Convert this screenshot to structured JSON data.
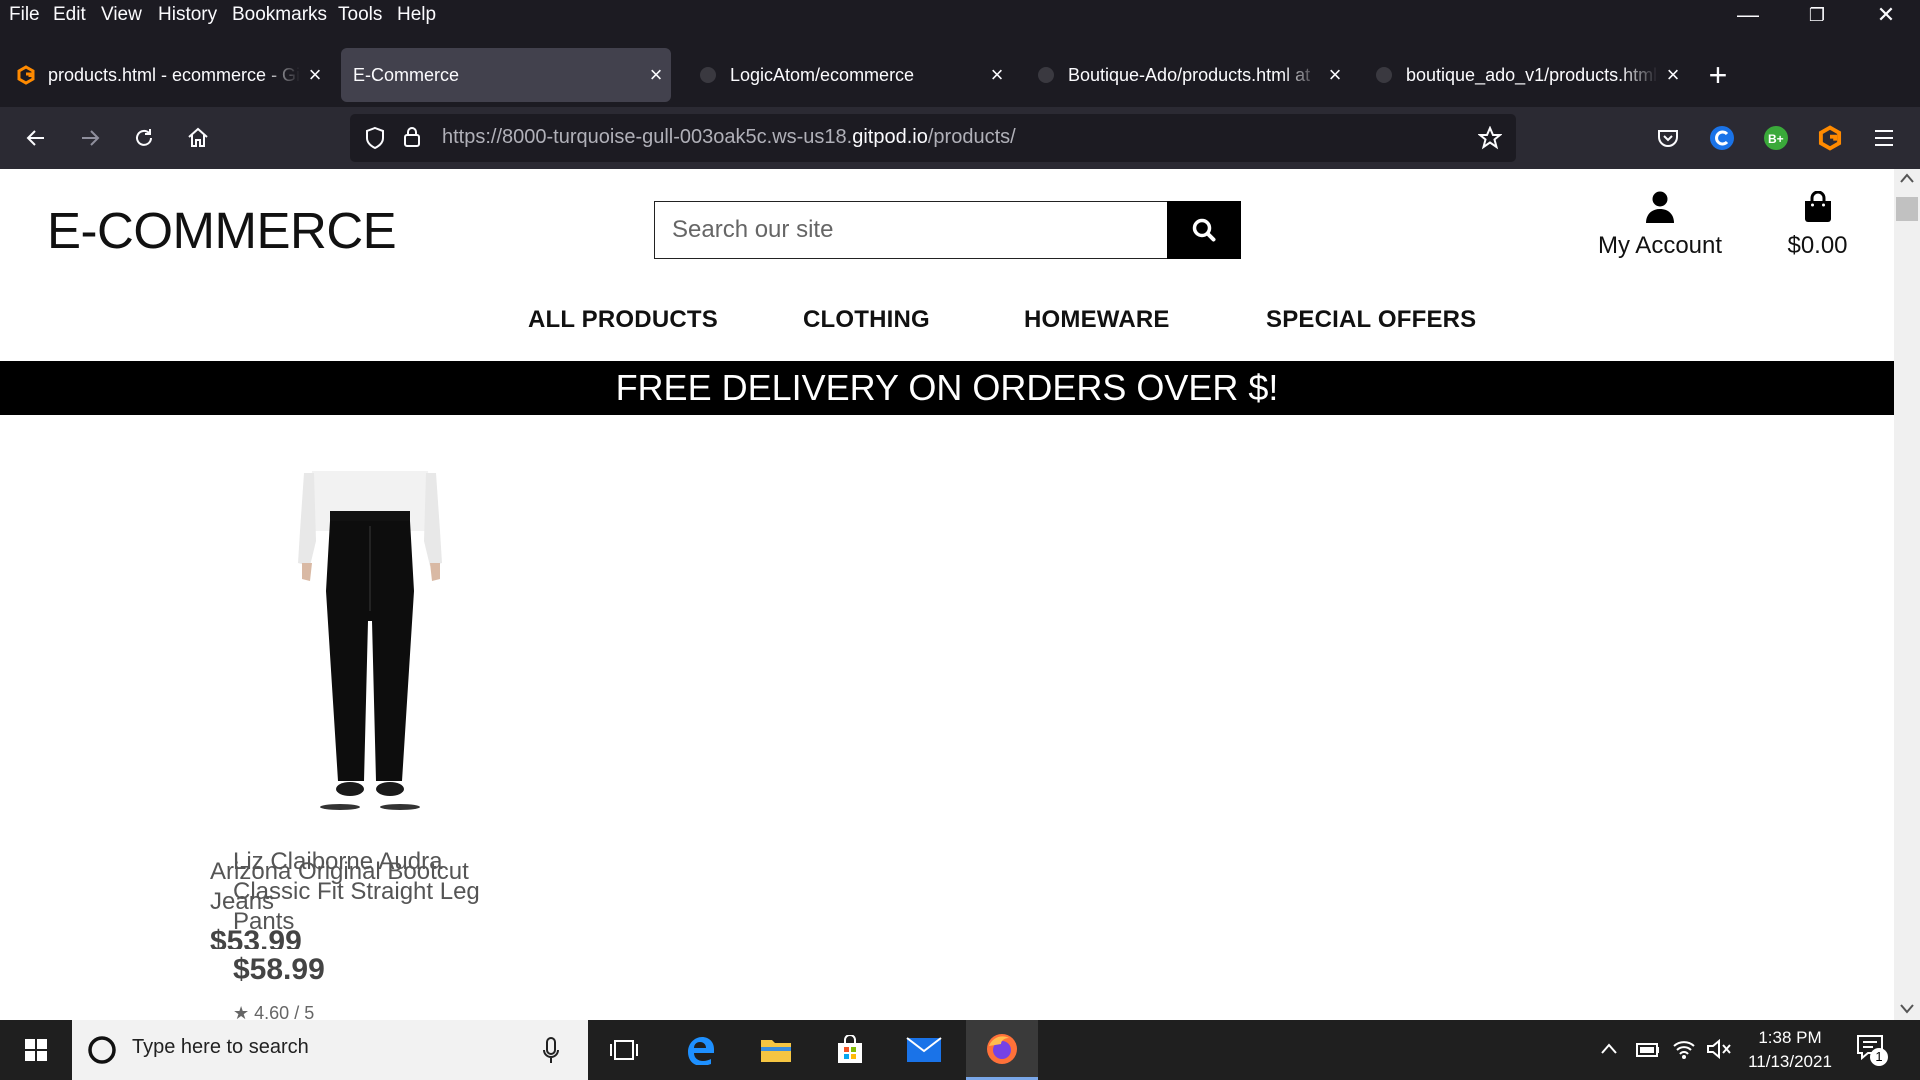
{
  "menubar": {
    "items": [
      "File",
      "Edit",
      "View",
      "History",
      "Bookmarks",
      "Tools",
      "Help"
    ]
  },
  "tabs": [
    {
      "title": "products.html - ecommerce - Gi",
      "favicon": "gitpod-icon",
      "active": false
    },
    {
      "title": "E-Commerce",
      "favicon": "none",
      "active": true
    },
    {
      "title": "LogicAtom/ecommerce",
      "favicon": "github-icon",
      "active": false
    },
    {
      "title": "Boutique-Ado/products.html at",
      "favicon": "github-icon",
      "active": false
    },
    {
      "title": "boutique_ado_v1/products.html",
      "favicon": "github-icon",
      "active": false
    }
  ],
  "urlbar": {
    "url_prefix": "https://8000-turquoise-gull-003oak5c.ws-us18.",
    "url_domain": "gitpod.io",
    "url_suffix": "/products/"
  },
  "site": {
    "logo": "E-COMMERCE",
    "search_placeholder": "Search our site",
    "account_label": "My Account",
    "cart_total": "$0.00",
    "nav": [
      "ALL PRODUCTS",
      "CLOTHING",
      "HOMEWARE",
      "SPECIAL OFFERS"
    ],
    "banner": "FREE DELIVERY ON ORDERS OVER $!"
  },
  "products": [
    {
      "name": "Liz Claiborne Audra Classic Fit Straight Leg Pants",
      "price": "$58.99",
      "rating": "4.60 / 5"
    },
    {
      "name": "Arizona Original Bootcut Jeans",
      "price": "$53.99"
    }
  ],
  "taskbar": {
    "search_placeholder": "Type here to search",
    "time": "1:38 PM",
    "date": "11/13/2021",
    "notifications": "1"
  },
  "colors": {
    "chrome_dark": "#1c1b22",
    "toolbar": "#2b2a33",
    "active_tab": "#42414d",
    "banner": "#000000",
    "taskbar": "#1f1f1f"
  }
}
